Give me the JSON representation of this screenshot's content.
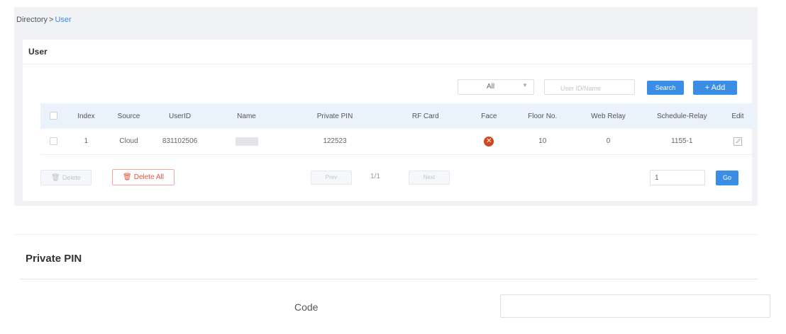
{
  "breadcrumb": {
    "root": "Directory",
    "separator": ">",
    "current": "User"
  },
  "user_card": {
    "title": "User",
    "filter": {
      "selected": "All"
    },
    "search": {
      "placeholder": "User ID/Name",
      "button": "Search"
    },
    "add_button": "+  Add",
    "columns": [
      "",
      "Index",
      "Source",
      "UserID",
      "Name",
      "Private PIN",
      "RF Card",
      "Face",
      "Floor No.",
      "Web Relay",
      "Schedule-Relay",
      "Edit"
    ],
    "rows": [
      {
        "index": "1",
        "source": "Cloud",
        "user_id": "831102506",
        "name": "",
        "private_pin": "122523",
        "rf_card": "",
        "face": "error-icon",
        "floor": "10",
        "web_relay": "0",
        "schedule_relay": "1155-1",
        "edit": "edit-icon"
      }
    ],
    "delete_button": "Delete",
    "delete_all_button": "Delete All",
    "pagination": {
      "prev": "Prev",
      "info": "1/1",
      "next": "Next",
      "page_input": "1",
      "go": "Go"
    }
  },
  "private_pin": {
    "title": "Private PIN",
    "code_label": "Code",
    "code_value": ""
  },
  "colors": {
    "accent": "#3a8ee6",
    "danger": "#e0553f",
    "header_bg": "#eaf3fc",
    "page_bg": "#f0f2f5"
  }
}
